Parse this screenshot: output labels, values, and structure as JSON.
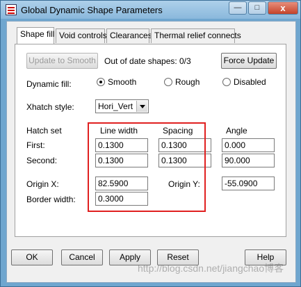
{
  "window": {
    "title": "Global Dynamic Shape Parameters",
    "minimize": "—",
    "maximize": "□",
    "close": "x"
  },
  "tabs": [
    "Shape fill",
    "Void controls",
    "Clearances",
    "Thermal relief connects"
  ],
  "shape_fill": {
    "update_to_smooth": "Update to Smooth",
    "out_of_date_label": "Out of date shapes:",
    "out_of_date_value": "0/3",
    "force_update": "Force Update",
    "dynamic_fill_label": "Dynamic fill:",
    "fill_options": [
      "Smooth",
      "Rough",
      "Disabled"
    ],
    "selected_fill": "Smooth",
    "xhatch_label": "Xhatch style:",
    "xhatch_value": "Hori_Vert",
    "hatch_set_label": "Hatch set",
    "col_line_width": "Line width",
    "col_spacing": "Spacing",
    "col_angle": "Angle",
    "first_label": "First:",
    "second_label": "Second:",
    "first_line_width": "0.1300",
    "first_spacing": "0.1300",
    "first_angle": "0.000",
    "second_line_width": "0.1300",
    "second_spacing": "0.1300",
    "second_angle": "90.000",
    "origin_x_label": "Origin X:",
    "origin_x": "82.5900",
    "origin_y_label": "Origin Y:",
    "origin_y": "-55.0900",
    "border_width_label": "Border width:",
    "border_width": "0.3000"
  },
  "footer": {
    "ok": "OK",
    "cancel": "Cancel",
    "apply": "Apply",
    "reset": "Reset",
    "help": "Help"
  },
  "watermark": "http://blog.csdn.net/jiangchao博客"
}
